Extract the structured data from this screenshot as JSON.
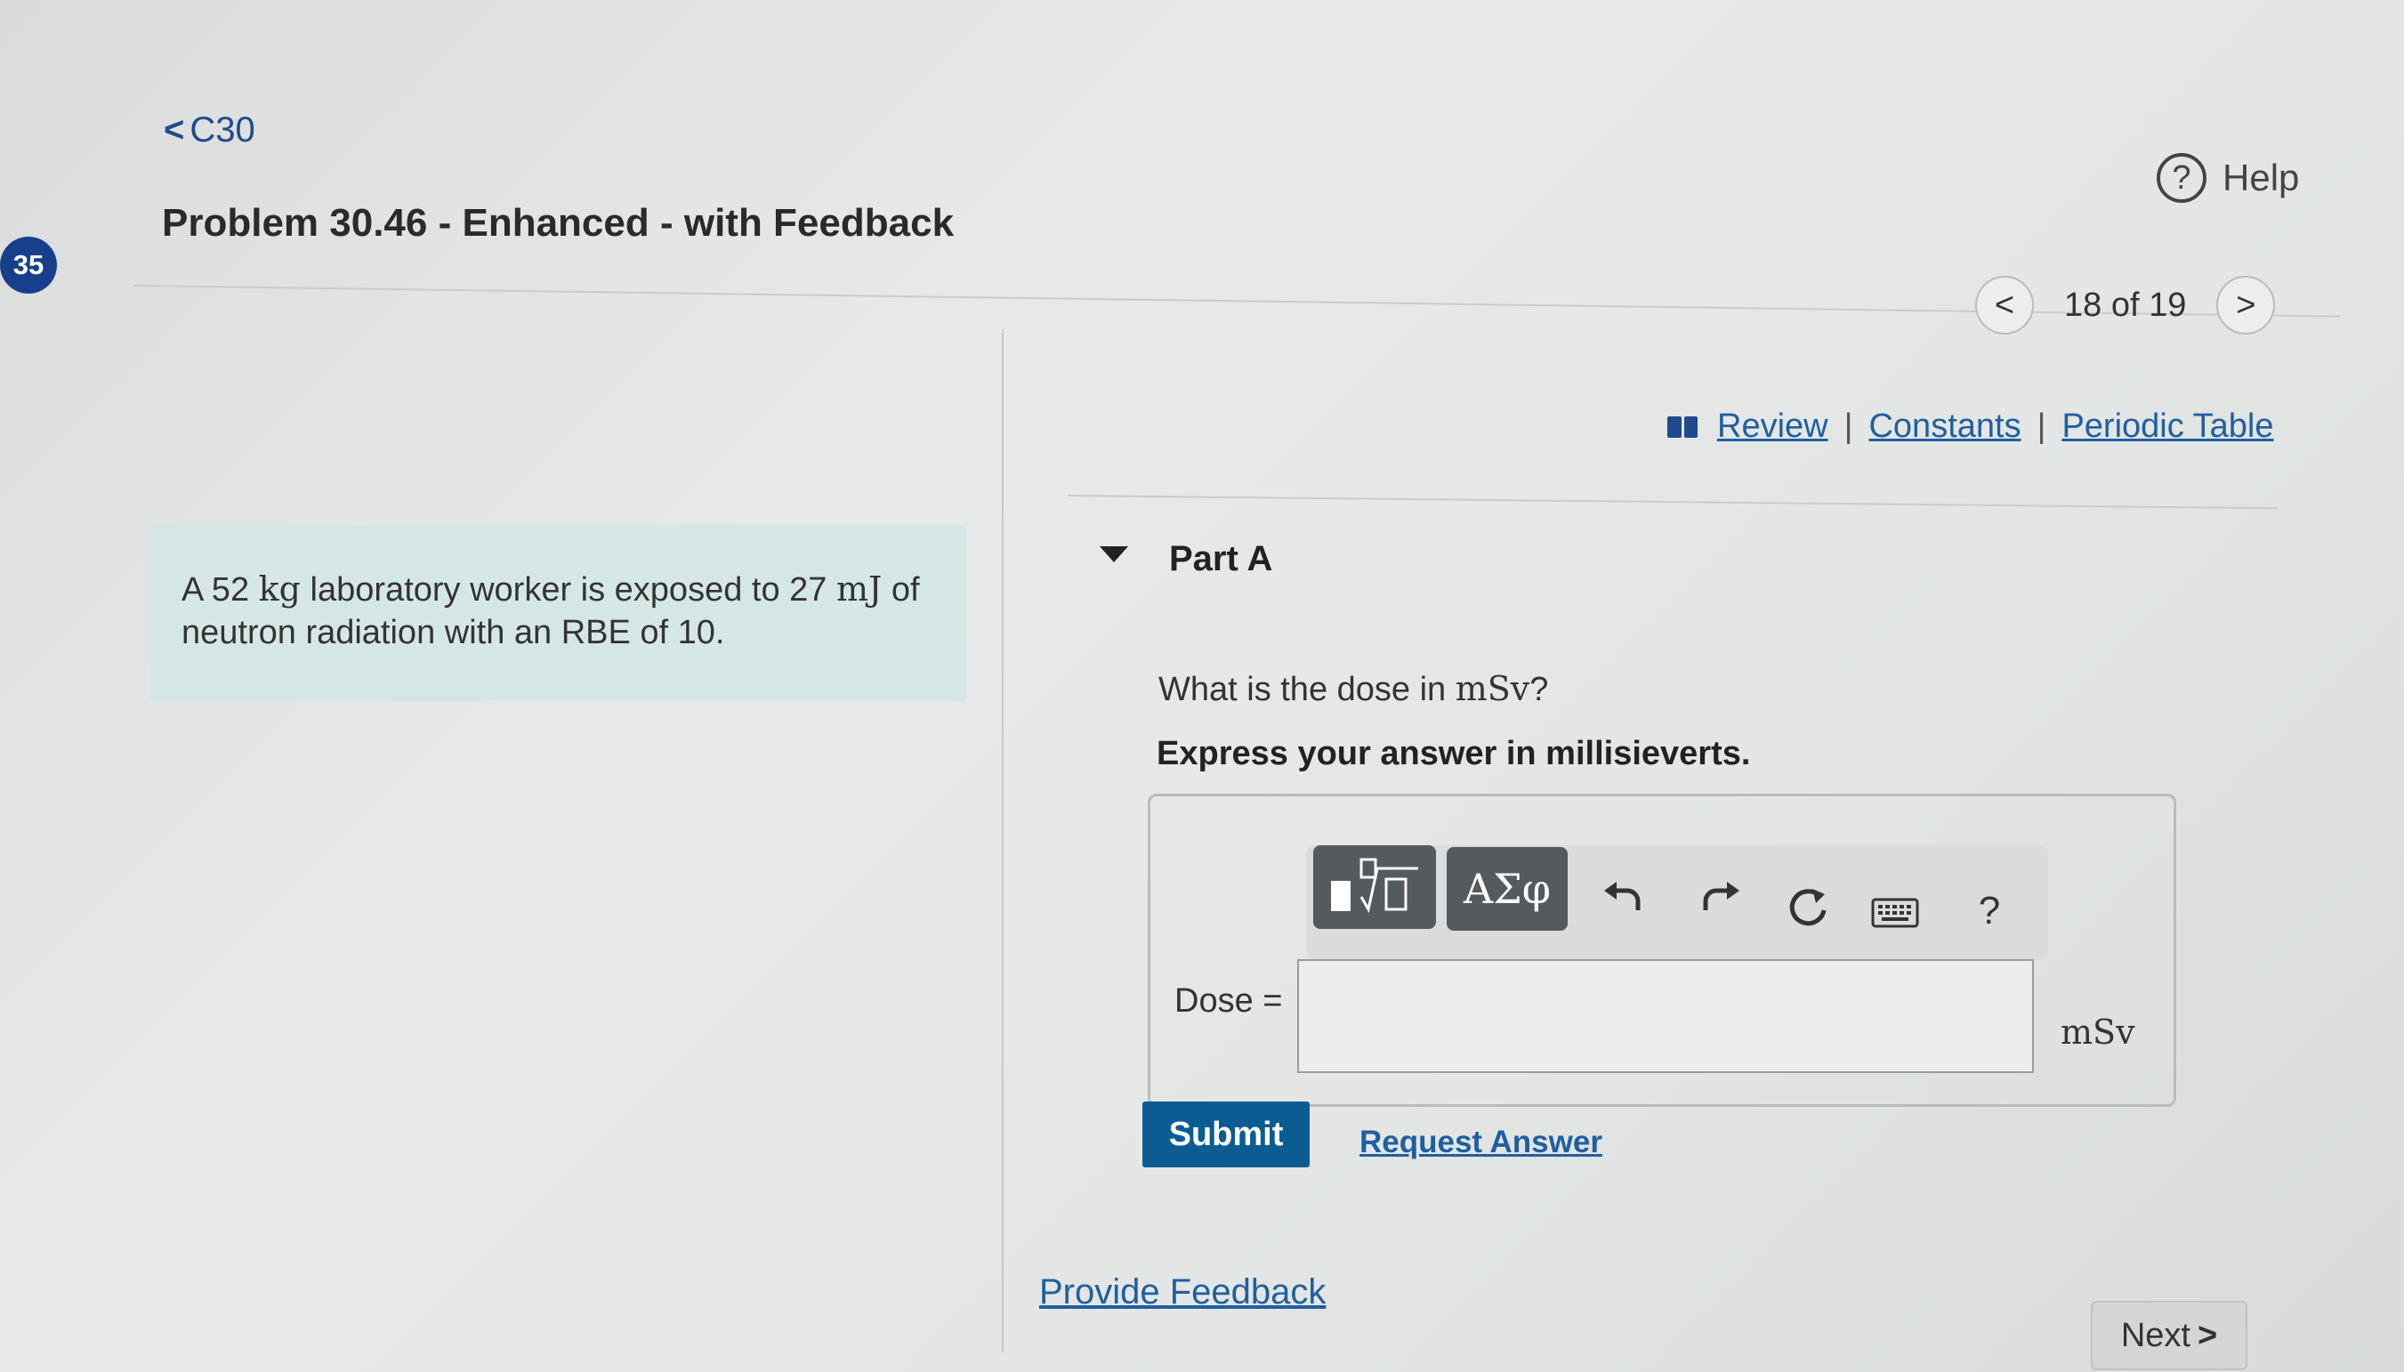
{
  "sidebar": {
    "badge": "35"
  },
  "header": {
    "back_label": "C30",
    "title": "Problem 30.46 - Enhanced - with Feedback",
    "help_label": "Help",
    "pager": {
      "text": "18 of 19"
    }
  },
  "resources": {
    "review": "Review",
    "constants": "Constants",
    "periodic_table": "Periodic Table",
    "separator": "|"
  },
  "problem": {
    "t1": "A 52 ",
    "u1": "kg",
    "t2": " laboratory worker is exposed to 27 ",
    "u2": "mJ",
    "t3": " of neutron radiation with an RBE of 10."
  },
  "part": {
    "label": "Part A",
    "question_prefix": "What is the dose in ",
    "question_unit": "mSv",
    "question_suffix": "?",
    "instruction": "Express your answer in millisieverts.",
    "toolbar": {
      "greek": "ΑΣφ",
      "help": "?"
    },
    "input_label": "Dose =",
    "input_value": "",
    "unit": "mSv",
    "submit": "Submit",
    "request_answer": "Request Answer"
  },
  "footer": {
    "feedback": "Provide Feedback",
    "next": "Next"
  }
}
